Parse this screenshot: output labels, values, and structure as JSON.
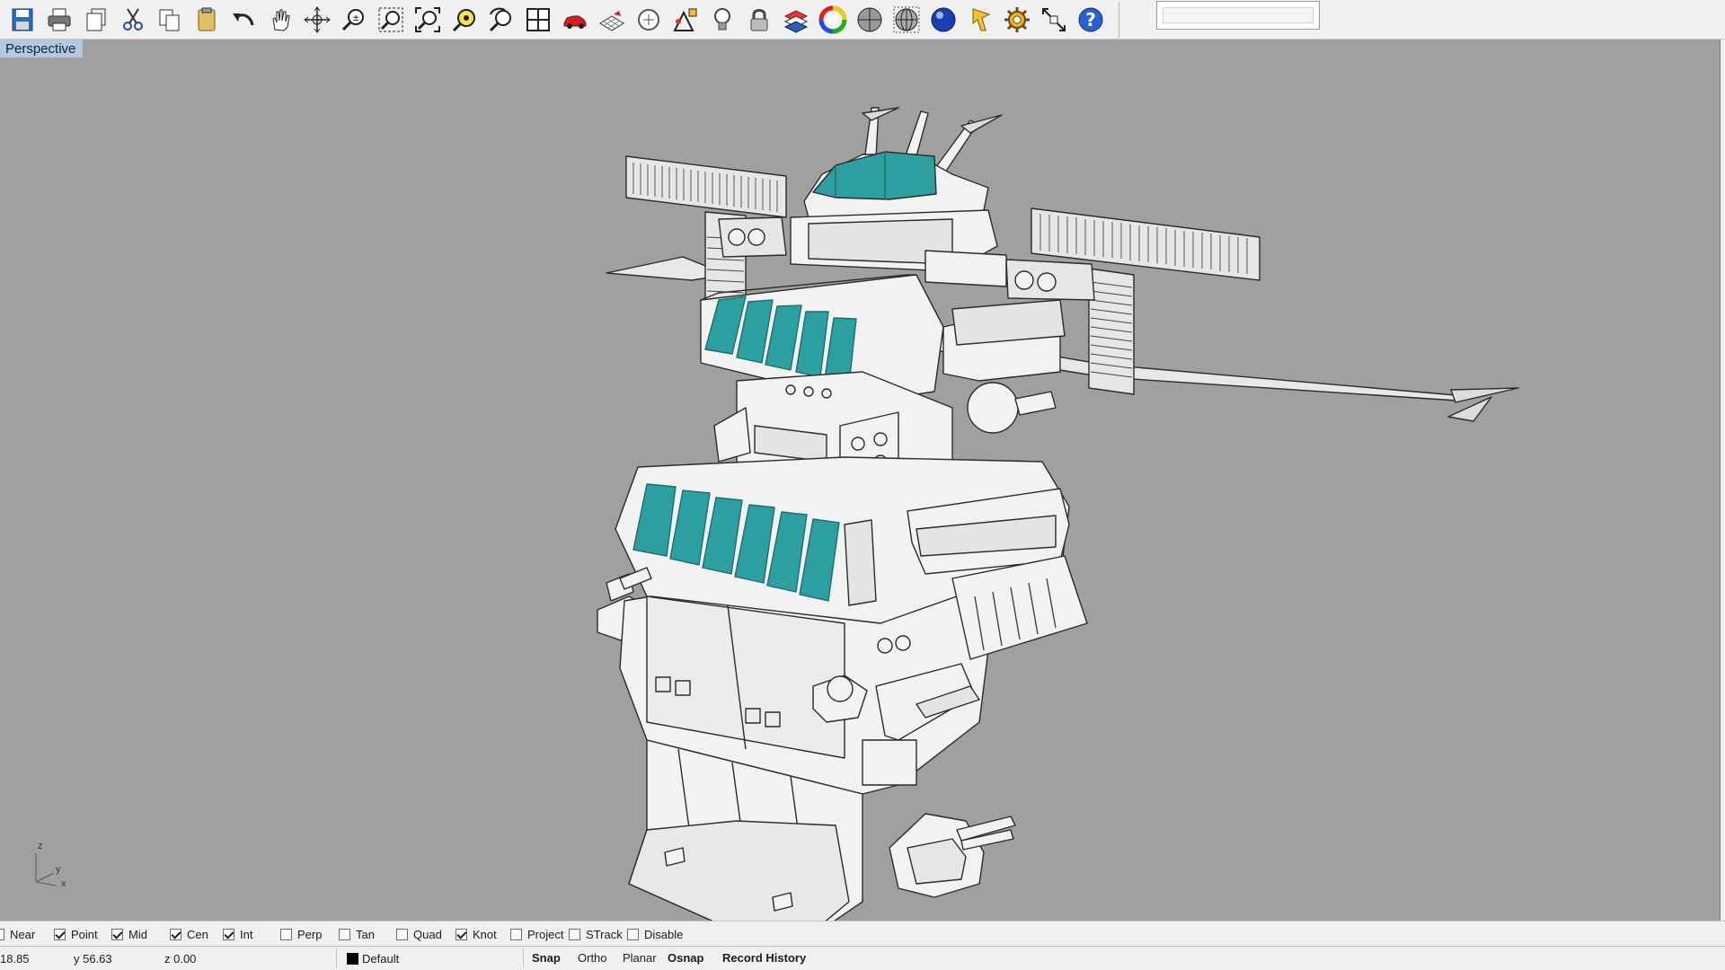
{
  "toolbar": {
    "buttons": [
      {
        "name": "save-icon"
      },
      {
        "name": "print-icon"
      },
      {
        "name": "copy-to-clipboard-icon"
      },
      {
        "name": "cut-icon"
      },
      {
        "name": "copy-icon"
      },
      {
        "name": "paste-icon"
      },
      {
        "name": "undo-icon"
      },
      {
        "name": "pan-icon"
      },
      {
        "name": "rotate-view-icon"
      },
      {
        "name": "zoom-dynamic-icon"
      },
      {
        "name": "zoom-window-icon"
      },
      {
        "name": "zoom-extents-icon"
      },
      {
        "name": "zoom-selected-icon"
      },
      {
        "name": "undo-view-change-icon"
      },
      {
        "name": "four-viewports-icon"
      },
      {
        "name": "car-options-icon"
      },
      {
        "name": "grid-options-icon"
      },
      {
        "name": "named-view-icon"
      },
      {
        "name": "object-snap-icon"
      },
      {
        "name": "light-bulb-icon"
      },
      {
        "name": "lock-icon"
      },
      {
        "name": "layer-icon"
      },
      {
        "name": "color-wheel-icon"
      },
      {
        "name": "shaded-sphere-icon"
      },
      {
        "name": "wireframe-sphere-icon"
      },
      {
        "name": "render-sphere-icon"
      },
      {
        "name": "select-filter-icon"
      },
      {
        "name": "settings-gear-icon"
      },
      {
        "name": "dimension-icon"
      },
      {
        "name": "help-icon"
      }
    ],
    "search_placeholder": ""
  },
  "viewport": {
    "title": "Perspective",
    "axis": {
      "z": "z",
      "y": "y",
      "x": "x"
    }
  },
  "colors": {
    "viewport_bg": "#a0a0a0",
    "model_surface": "#f2f2f2",
    "model_edge": "#2b2b2b",
    "accent_teal": "#2e9fa0",
    "title_bg": "#b4c9e0"
  },
  "osnap": {
    "items": [
      {
        "label": "Near",
        "checked": false
      },
      {
        "label": "Point",
        "checked": true
      },
      {
        "label": "Mid",
        "checked": true
      },
      {
        "label": "Cen",
        "checked": true
      },
      {
        "label": "Int",
        "checked": true
      },
      {
        "label": "Perp",
        "checked": false
      },
      {
        "label": "Tan",
        "checked": false
      },
      {
        "label": "Quad",
        "checked": false
      },
      {
        "label": "Knot",
        "checked": true
      },
      {
        "label": "Project",
        "checked": false
      },
      {
        "label": "STrack",
        "checked": false
      },
      {
        "label": "Disable",
        "checked": false
      }
    ]
  },
  "status": {
    "x": "18.85",
    "y": "y 56.63",
    "z": "z 0.00",
    "layer": "Default",
    "panes": [
      {
        "label": "Snap",
        "bold": true
      },
      {
        "label": "Ortho",
        "bold": false
      },
      {
        "label": "Planar",
        "bold": false
      },
      {
        "label": "Osnap",
        "bold": true
      },
      {
        "label": "Record History",
        "bold": true
      }
    ]
  }
}
